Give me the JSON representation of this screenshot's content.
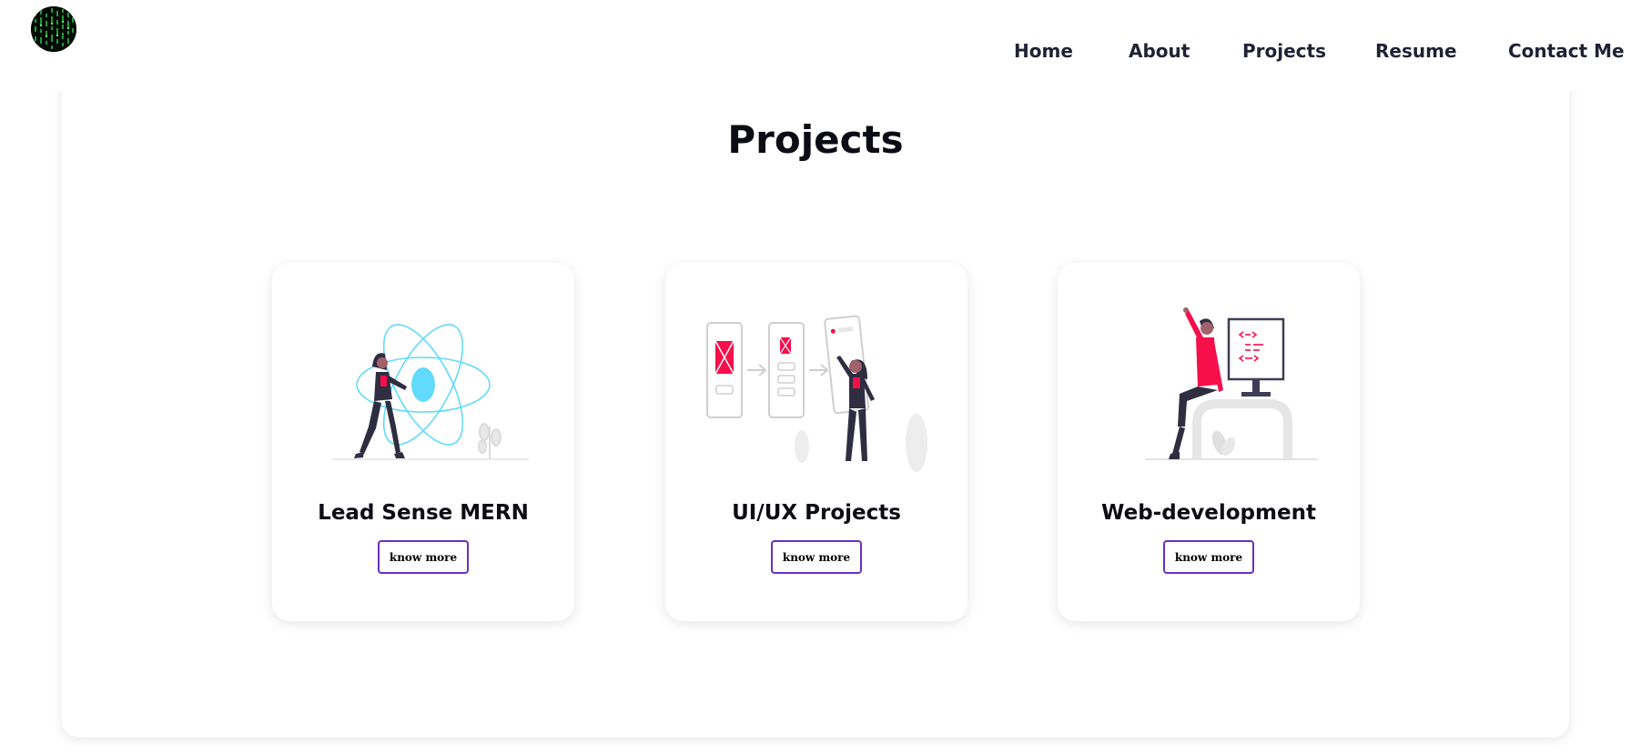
{
  "header": {
    "logo_icon": "matrix-code-avatar",
    "nav": [
      "Home",
      "About",
      "Projects",
      "Resume",
      "Contact Me"
    ]
  },
  "projects": {
    "title": "Projects",
    "cards": [
      {
        "title": "Lead Sense MERN",
        "button": "know more",
        "illustration": "react-atom-woman-icon"
      },
      {
        "title": "UI/UX Projects",
        "button": "know more",
        "illustration": "wireframe-flow-woman-icon"
      },
      {
        "title": "Web-development",
        "button": "know more",
        "illustration": "developer-monitor-woman-icon"
      }
    ]
  },
  "colors": {
    "text": "#1f2233",
    "heading": "#0c0c14",
    "button_border": "#6a2fc4",
    "accent_pink": "#f50f4b",
    "accent_cyan": "#61dafb"
  }
}
